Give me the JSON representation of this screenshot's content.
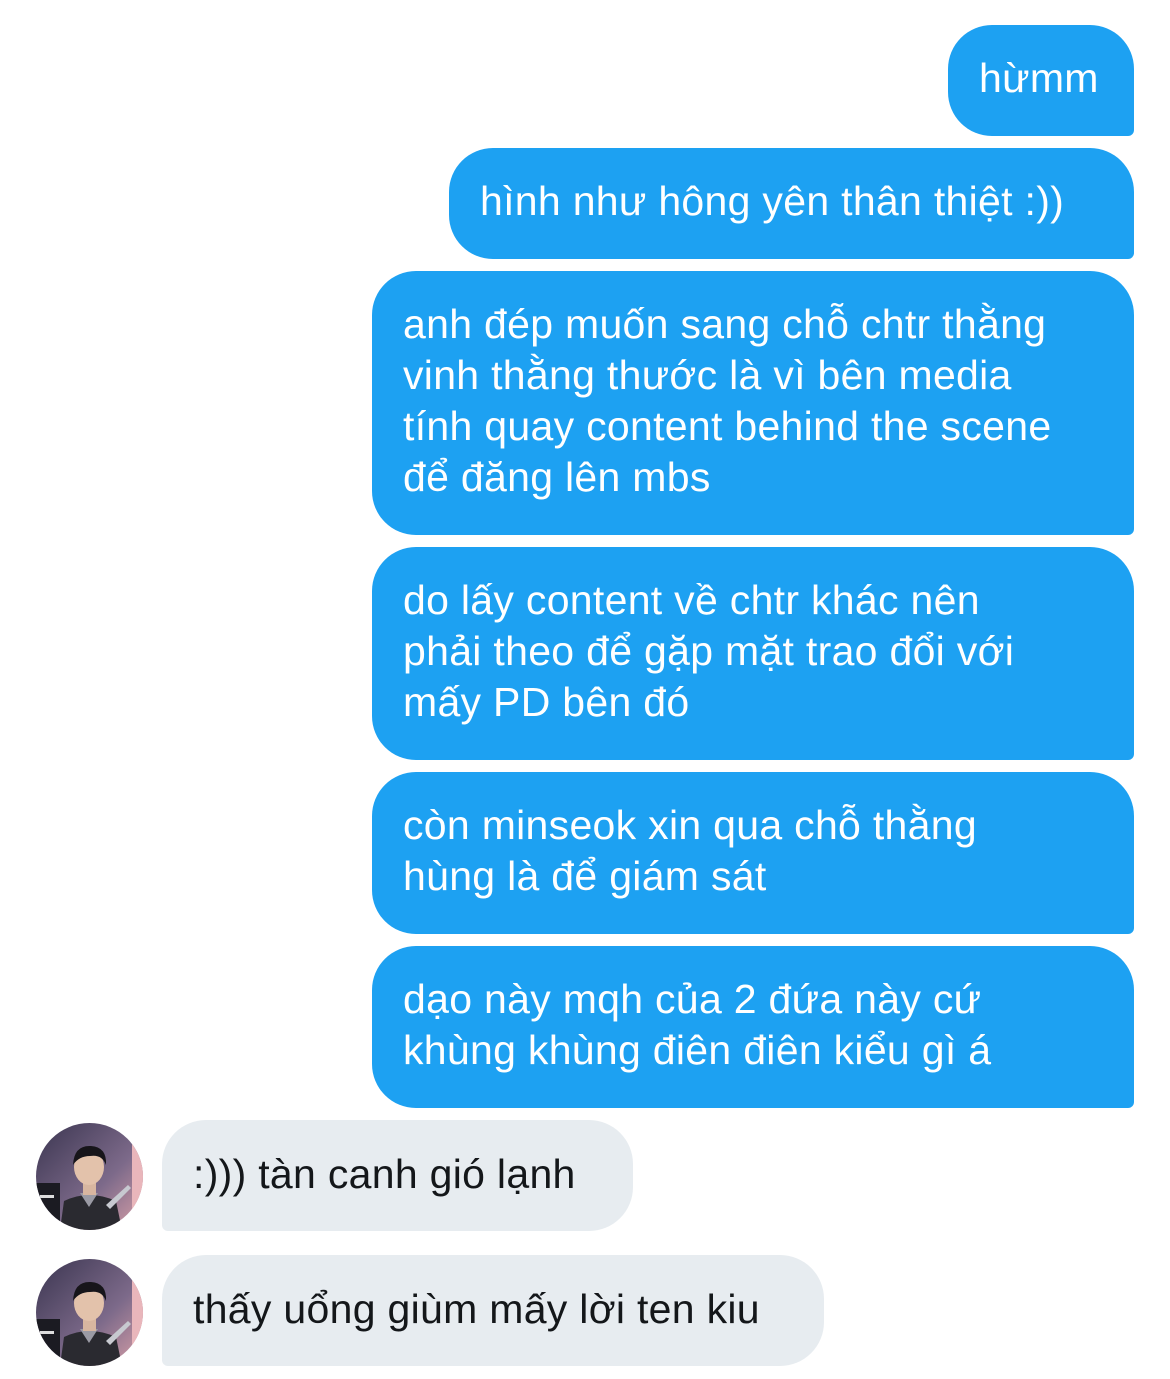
{
  "conversation": {
    "outgoing": [
      {
        "lines": [
          "hừmm"
        ]
      },
      {
        "lines": [
          "hình như hông yên thân thiệt :))"
        ]
      },
      {
        "lines": [
          "anh đép muốn sang chỗ chtr thằng",
          "vinh thằng thước là vì bên media",
          "tính quay content behind the scene",
          "để đăng lên mbs"
        ]
      },
      {
        "lines": [
          "do lấy content về chtr khác nên",
          "phải theo để gặp mặt trao đổi với",
          "mấy PD bên đó"
        ]
      },
      {
        "lines": [
          "còn minseok xin qua chỗ thằng",
          "hùng là để giám sát"
        ]
      },
      {
        "lines": [
          "dạo này mqh của 2 đứa này cứ",
          "khùng khùng điên điên kiểu gì á"
        ]
      }
    ],
    "incoming": [
      {
        "lines": [
          ":))) tàn canh gió lạnh"
        ]
      },
      {
        "lines": [
          "thấy uổng giùm mấy lời ten kiu"
        ]
      }
    ]
  },
  "colors": {
    "outgoing_bubble": "#1da1f2",
    "outgoing_text": "#ffffff",
    "incoming_bubble": "#e7ecf0",
    "incoming_text": "#14171a",
    "background": "#ffffff"
  }
}
